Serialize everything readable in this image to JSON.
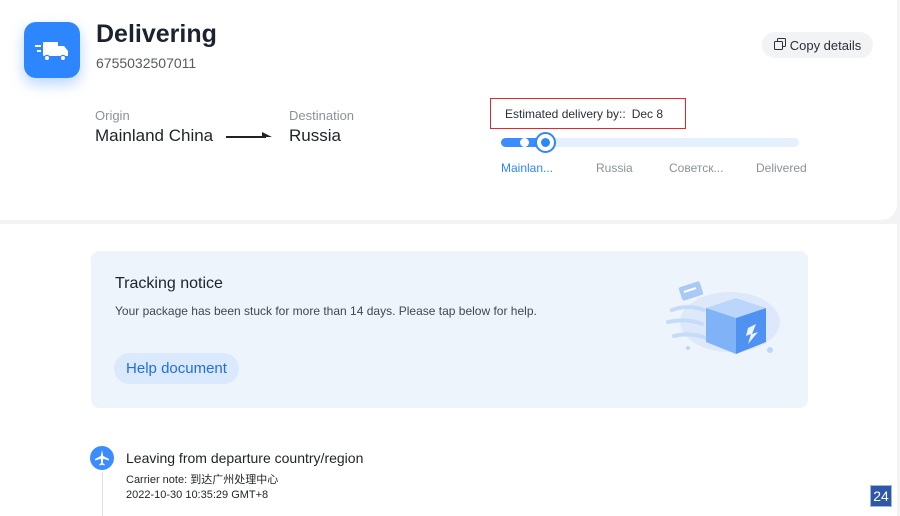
{
  "status": {
    "title": "Delivering",
    "tracking_number": "6755032507011",
    "icon": "delivery-truck-icon"
  },
  "actions": {
    "copy_label": "Copy details",
    "copy_icon": "copy-icon"
  },
  "route": {
    "origin_label": "Origin",
    "origin_value": "Mainland China",
    "destination_label": "Destination",
    "destination_value": "Russia"
  },
  "eta": {
    "label": "Estimated delivery by::",
    "date": "Dec 8"
  },
  "progress": {
    "fraction": 0.15,
    "steps": [
      "Mainlan...",
      "Russia",
      "Советск...",
      "Delivered"
    ],
    "active_step": 0
  },
  "notice": {
    "title": "Tracking notice",
    "text": "Your package has been stuck for more than 14 days. Please tap below for help.",
    "button_label": "Help document"
  },
  "events": [
    {
      "title": "Leaving from departure country/region",
      "note": "Carrier note: 到达广州处理中心",
      "time": "2022-10-30 10:35:29 GMT+8",
      "icon": "airplane-icon"
    }
  ],
  "badge": {
    "text": "24"
  },
  "colors": {
    "accent": "#2e86ff",
    "highlight_border": "#e0282e",
    "notice_bg": "#eef4fc"
  }
}
